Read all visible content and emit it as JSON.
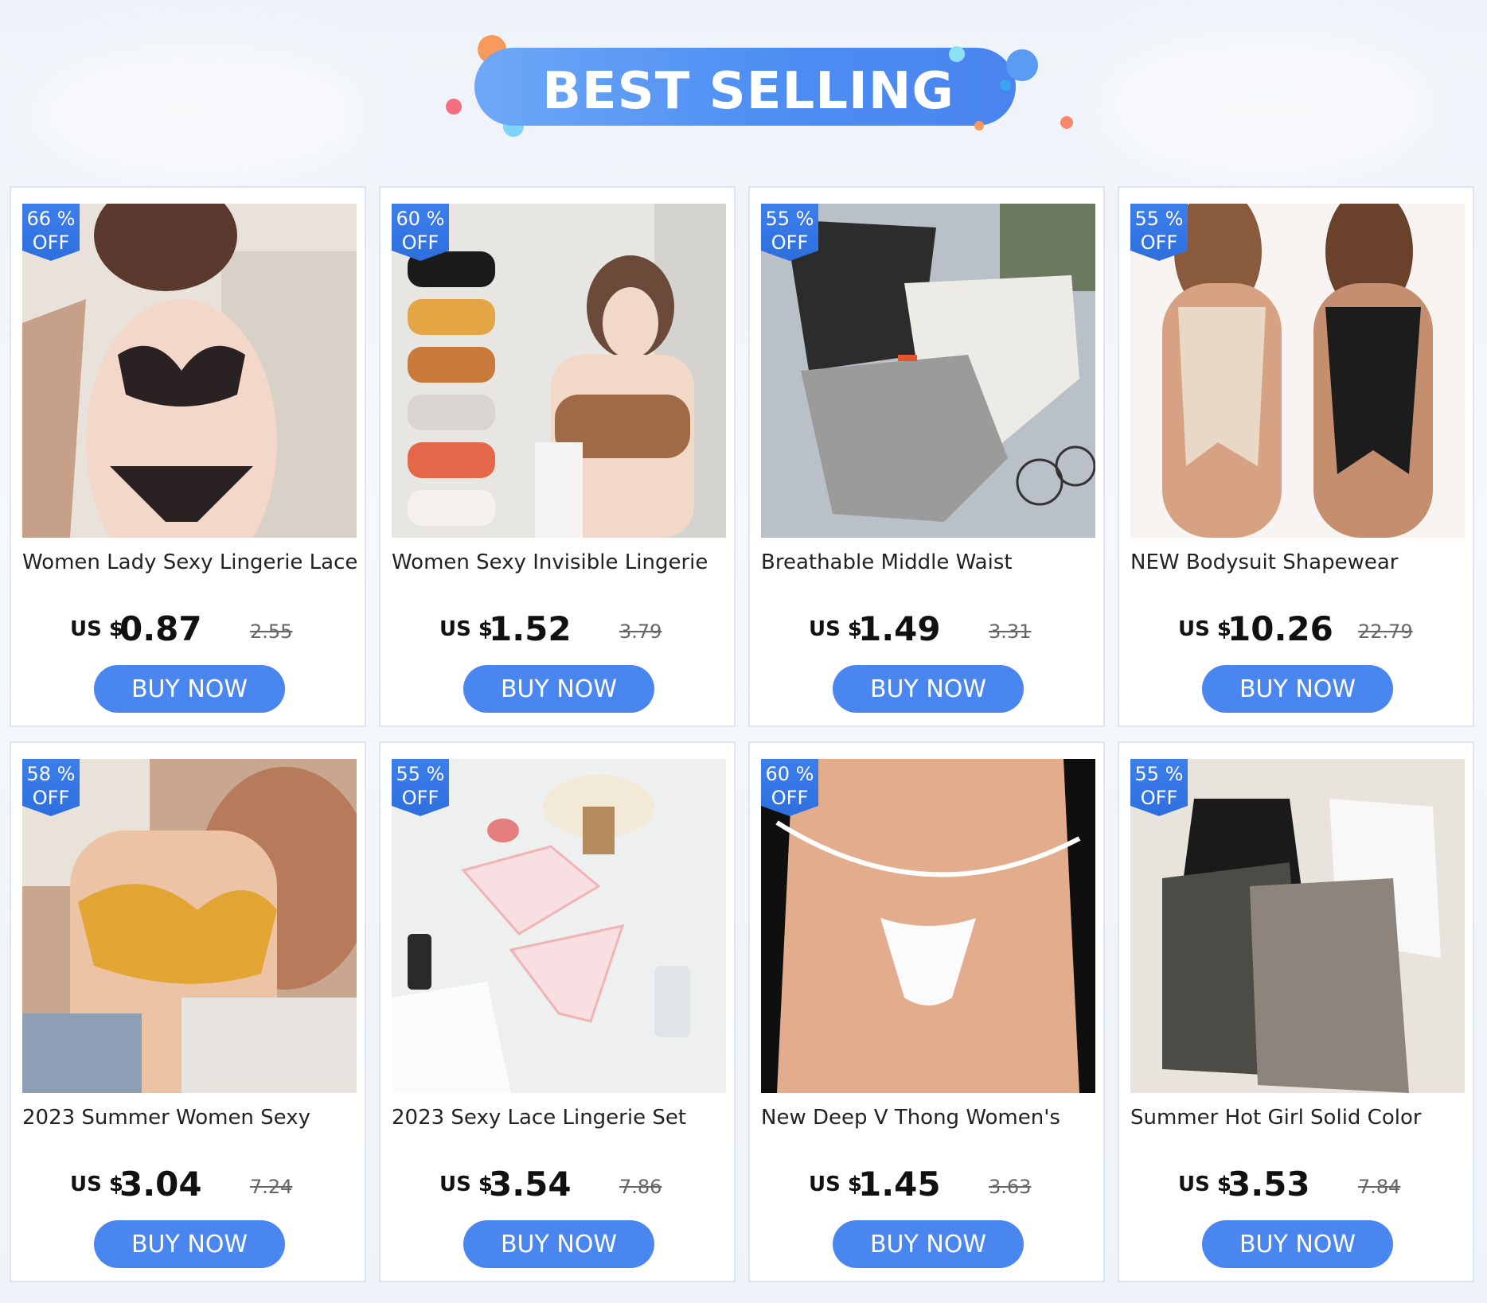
{
  "header": {
    "title": "BEST SELLING"
  },
  "colors": {
    "accent": "#4a86ef",
    "badge": "#2e6fdf",
    "card_border": "#dfe5ee"
  },
  "products": [
    {
      "discount_pct": "66 %",
      "discount_off": "OFF",
      "title": "Women Lady Sexy Lingerie Lace",
      "currency": "US $",
      "price": "0.87",
      "original_price": "2.55",
      "button": "BUY NOW"
    },
    {
      "discount_pct": "60 %",
      "discount_off": "OFF",
      "title": "Women Sexy Invisible Lingerie",
      "currency": "US $",
      "price": "1.52",
      "original_price": "3.79",
      "button": "BUY NOW"
    },
    {
      "discount_pct": "55 %",
      "discount_off": "OFF",
      "title": "Breathable Middle Waist",
      "currency": "US $",
      "price": "1.49",
      "original_price": "3.31",
      "button": "BUY NOW"
    },
    {
      "discount_pct": "55 %",
      "discount_off": "OFF",
      "title": "NEW Bodysuit Shapewear",
      "currency": "US $",
      "price": "10.26",
      "original_price": "22.79",
      "button": "BUY NOW"
    },
    {
      "discount_pct": "58 %",
      "discount_off": "OFF",
      "title": "2023 Summer Women Sexy",
      "currency": "US $",
      "price": "3.04",
      "original_price": "7.24",
      "button": "BUY NOW"
    },
    {
      "discount_pct": "55 %",
      "discount_off": "OFF",
      "title": "2023 Sexy Lace Lingerie Set",
      "currency": "US $",
      "price": "3.54",
      "original_price": "7.86",
      "button": "BUY NOW"
    },
    {
      "discount_pct": "60 %",
      "discount_off": "OFF",
      "title": "New Deep V Thong Women's",
      "currency": "US $",
      "price": "1.45",
      "original_price": "3.63",
      "button": "BUY NOW"
    },
    {
      "discount_pct": "55 %",
      "discount_off": "OFF",
      "title": "Summer Hot Girl Solid Color",
      "currency": "US $",
      "price": "3.53",
      "original_price": "7.84",
      "button": "BUY NOW"
    }
  ]
}
